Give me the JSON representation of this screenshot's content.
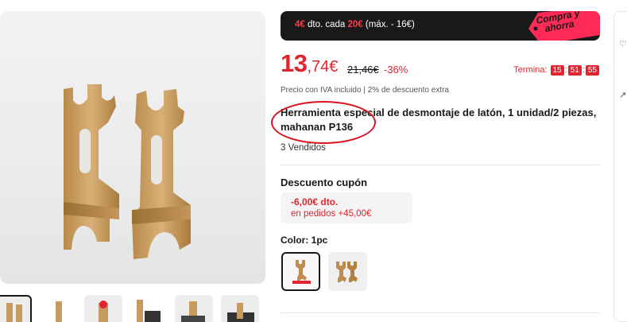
{
  "promo": {
    "amount_off": "4€",
    "text_dto_cada": " dto. cada ",
    "threshold": "20€",
    "text_max": " (máx. - 16€)",
    "tag_line1": "Compra y",
    "tag_line2": "ahorra",
    "colors": {
      "banner": "#191919",
      "tag": "#ff2a55",
      "accent": "#ff3b4a"
    }
  },
  "price": {
    "integer": "13",
    "decimal": ",74€",
    "original": "21,46€",
    "discount": "-36%",
    "color": "#e1242f"
  },
  "timer": {
    "label": "Termina:",
    "hours": "15",
    "minutes": "51",
    "seconds": "55",
    "separator": ":"
  },
  "vat_note": "Precio con IVA incluido | 2% de descuento extra",
  "product": {
    "title": "Herramienta especial de desmontaje de latón, 1 unidad/2 piezas, mahanan P136",
    "sold": "3 Vendidos"
  },
  "coupon": {
    "heading": "Descuento cupón",
    "amount": "-6,00€ dto.",
    "condition": "en pedidos +45,00€"
  },
  "color": {
    "label": "Color: 1pc",
    "options": [
      "1pc",
      "2pcs"
    ],
    "selected": "1pc"
  },
  "gallery": {
    "main_icon": "brass-tool-image",
    "thumbnail_count": 6,
    "selected_thumbnail": 0
  },
  "right_panel": {
    "icons": [
      "heart-icon",
      "share-icon"
    ]
  }
}
